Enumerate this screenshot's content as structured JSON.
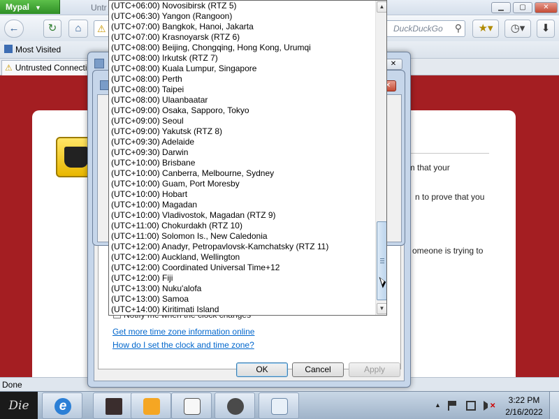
{
  "browser": {
    "app_button": "Mypal",
    "tab_title": "Untrusted Connection",
    "tab_title_short": "Untr",
    "search_placeholder": "DuckDuckGo",
    "bookmarks": {
      "most_visited": "Most Visited"
    },
    "status": "Done"
  },
  "page": {
    "fragments": [
      "nfirm that your",
      "n to prove that you",
      "omeone is trying to"
    ]
  },
  "dialog": {
    "notify_text": "Notify me when the clock changes",
    "links": {
      "more_info": "Get more time zone information online",
      "how_to": "How do I set the clock and time zone?"
    },
    "buttons": {
      "ok": "OK",
      "cancel": "Cancel",
      "apply": "Apply"
    }
  },
  "timezone_list": {
    "items": [
      "(UTC+06:00) Novosibirsk (RTZ 5)",
      "(UTC+06:30) Yangon (Rangoon)",
      "(UTC+07:00) Bangkok, Hanoi, Jakarta",
      "(UTC+07:00) Krasnoyarsk (RTZ 6)",
      "(UTC+08:00) Beijing, Chongqing, Hong Kong, Urumqi",
      "(UTC+08:00) Irkutsk (RTZ 7)",
      "(UTC+08:00) Kuala Lumpur, Singapore",
      "(UTC+08:00) Perth",
      "(UTC+08:00) Taipei",
      "(UTC+08:00) Ulaanbaatar",
      "(UTC+09:00) Osaka, Sapporo, Tokyo",
      "(UTC+09:00) Seoul",
      "(UTC+09:00) Yakutsk (RTZ 8)",
      "(UTC+09:30) Adelaide",
      "(UTC+09:30) Darwin",
      "(UTC+10:00) Brisbane",
      "(UTC+10:00) Canberra, Melbourne, Sydney",
      "(UTC+10:00) Guam, Port Moresby",
      "(UTC+10:00) Hobart",
      "(UTC+10:00) Magadan",
      "(UTC+10:00) Vladivostok, Magadan (RTZ 9)",
      "(UTC+11:00) Chokurdakh (RTZ 10)",
      "(UTC+11:00) Solomon Is., New Caledonia",
      "(UTC+12:00) Anadyr, Petropavlovsk-Kamchatsky (RTZ 11)",
      "(UTC+12:00) Auckland, Wellington",
      "(UTC+12:00) Coordinated Universal Time+12",
      "(UTC+12:00) Fiji",
      "(UTC+13:00) Nuku'alofa",
      "(UTC+13:00) Samoa",
      "(UTC+14:00) Kiritimati Island"
    ]
  },
  "taskbar": {
    "start_label": "Die",
    "ie_glyph": "e",
    "clock_time": "3:22 PM",
    "clock_date": "2/16/2022"
  },
  "colors": {
    "page_background": "#a41e22",
    "app_button": "#2f8f26",
    "link": "#0066cc"
  }
}
